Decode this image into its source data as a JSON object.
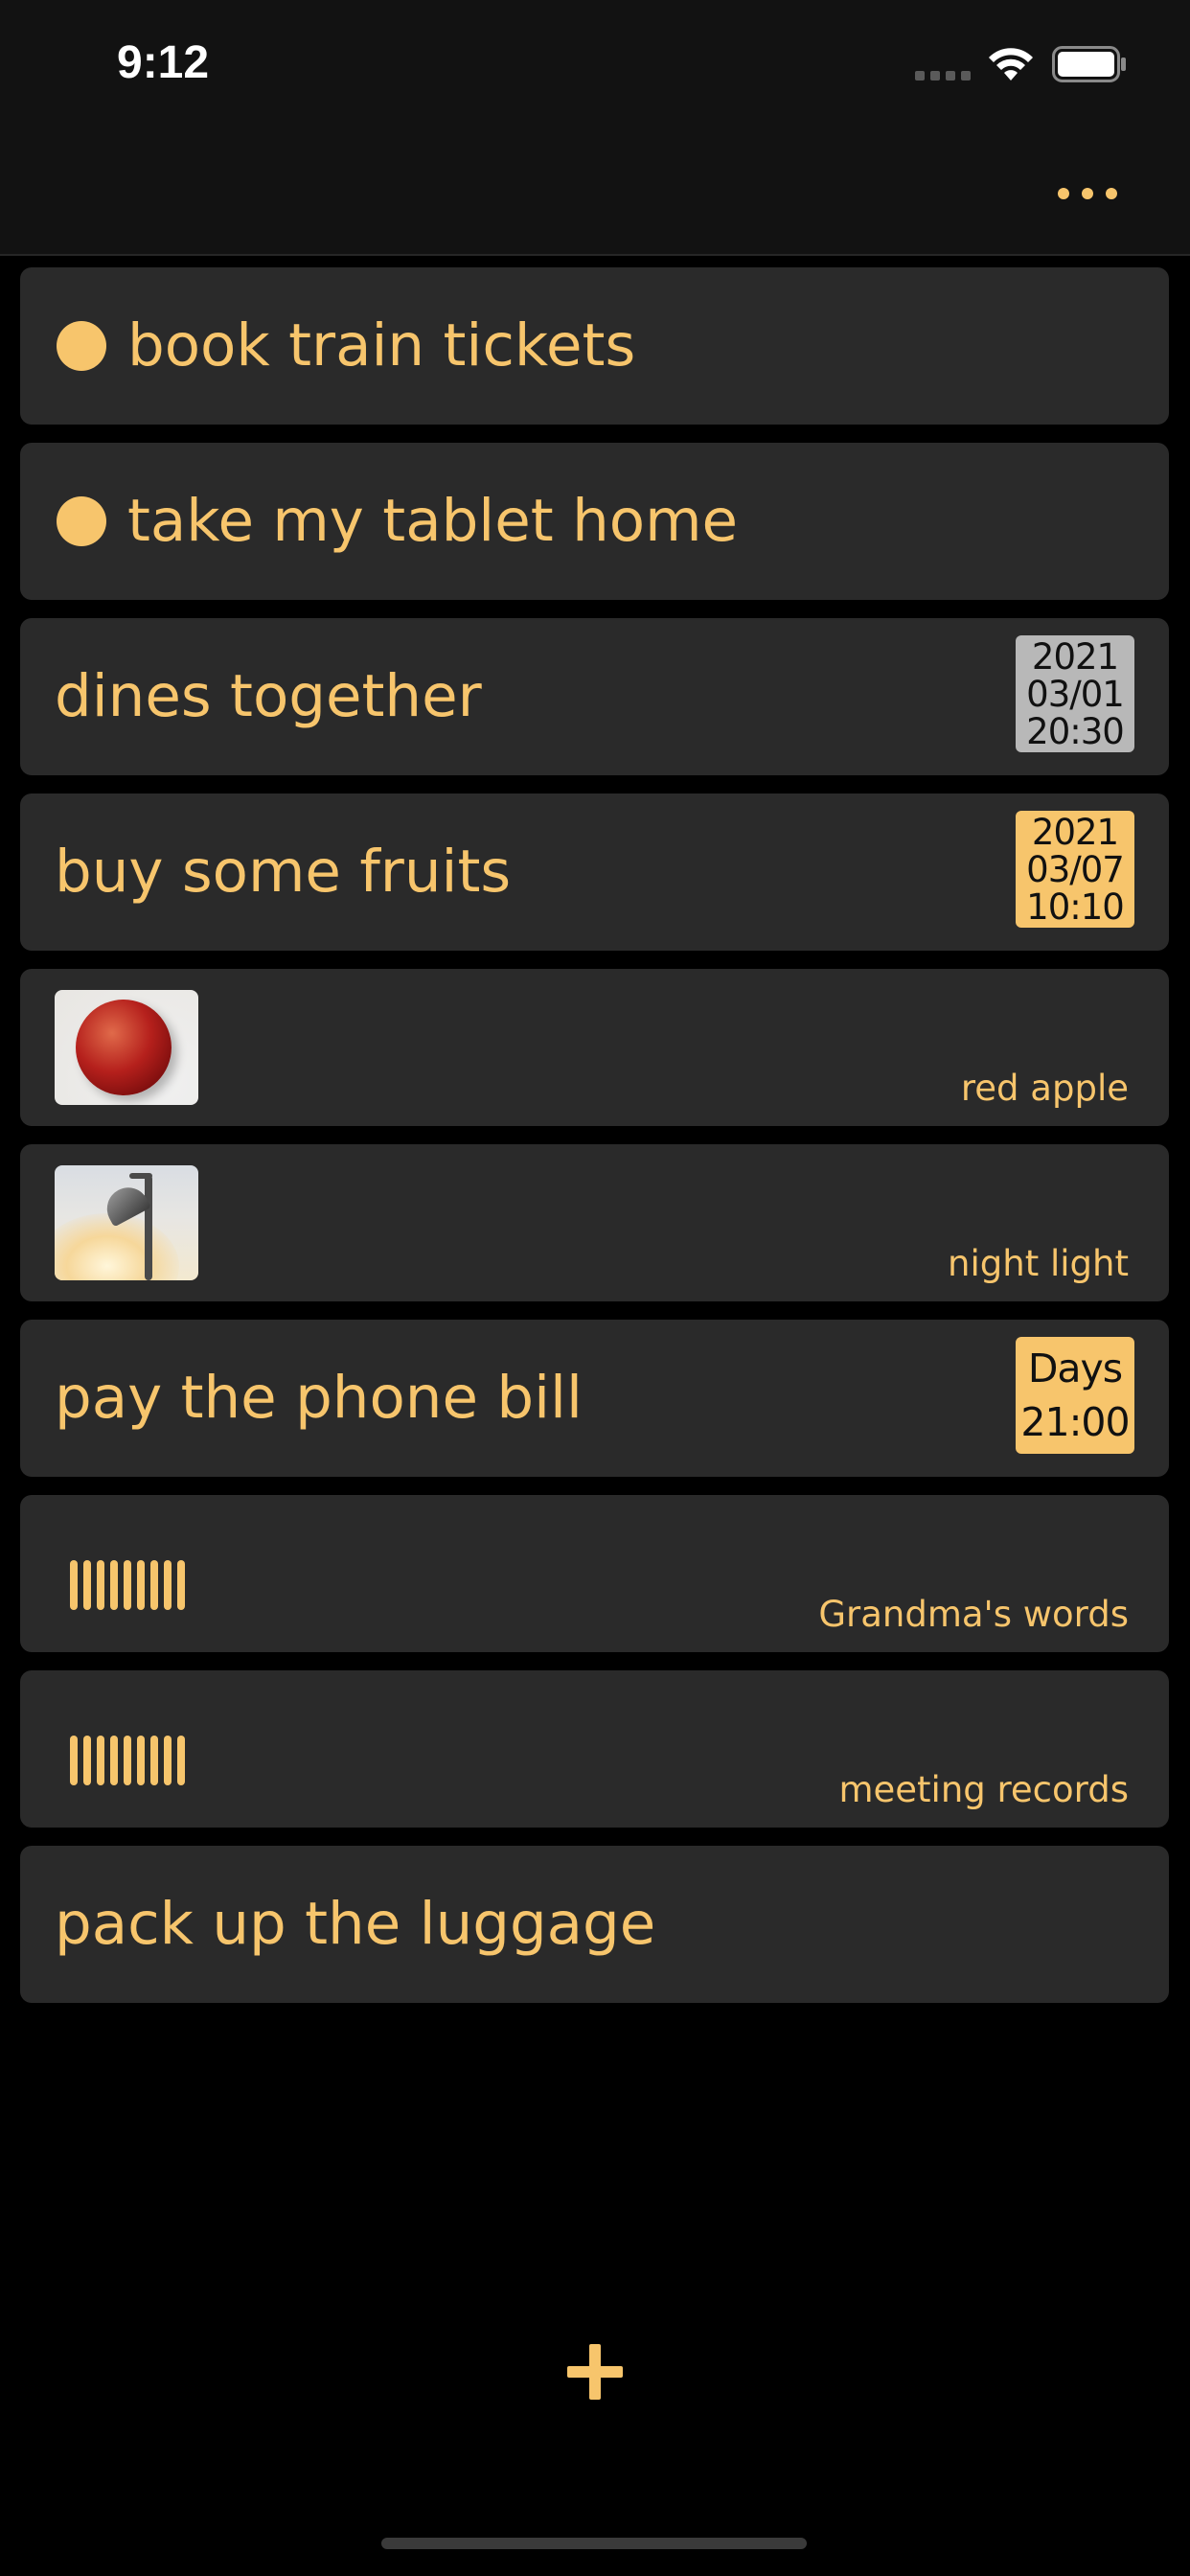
{
  "status_bar": {
    "time": "9:12",
    "signal_icon": "cellular-signal-icon",
    "wifi_icon": "wifi-icon",
    "battery_icon": "battery-icon"
  },
  "nav": {
    "more_icon": "more-horizontal-icon"
  },
  "colors": {
    "accent": "#f7c56c",
    "card_bg": "#2a2a2a",
    "background": "#000000",
    "badge_gray": "#b8b8b8"
  },
  "items": [
    {
      "type": "text",
      "title": "book train tickets",
      "dot": true
    },
    {
      "type": "text",
      "title": "take my tablet home",
      "dot": true
    },
    {
      "type": "dated",
      "title": "dines together",
      "badge": [
        "2021",
        "03/01",
        "20:30"
      ],
      "badge_style": "gray"
    },
    {
      "type": "dated",
      "title": "buy some fruits",
      "badge": [
        "2021",
        "03/07",
        "10:10"
      ],
      "badge_style": "yellow"
    },
    {
      "type": "photo",
      "caption": "red apple",
      "image": "apple-photo"
    },
    {
      "type": "photo",
      "caption": "night light",
      "image": "desk-lamp-photo"
    },
    {
      "type": "repeat",
      "title": "pay the phone bill",
      "badge": [
        "Days",
        "21:00"
      ],
      "badge_style": "yellow"
    },
    {
      "type": "audio",
      "caption": "Grandma's words",
      "icon": "audio-waveform-icon"
    },
    {
      "type": "audio",
      "caption": "meeting records",
      "icon": "audio-waveform-icon"
    },
    {
      "type": "text",
      "title": "pack up the luggage",
      "dot": false
    }
  ],
  "add_button_icon": "plus-icon"
}
